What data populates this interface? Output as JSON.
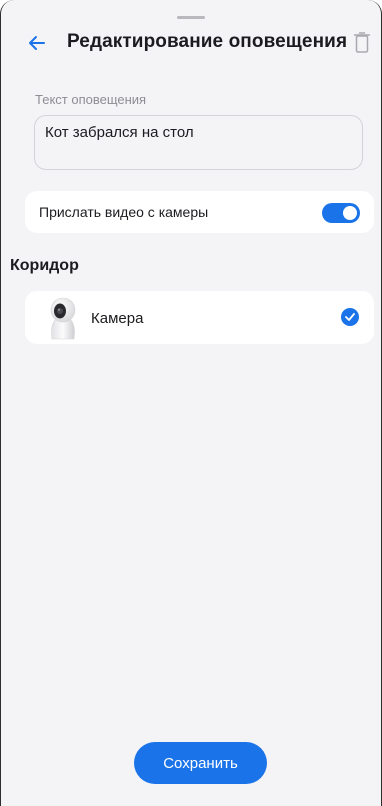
{
  "header": {
    "title": "Редактирование оповещения",
    "back_icon": "arrow-left-icon",
    "delete_icon": "trash-icon"
  },
  "notification_text": {
    "label": "Текст оповещения",
    "value": "Кот забрался на стол"
  },
  "send_video": {
    "label": "Прислать видео с камеры",
    "enabled": true
  },
  "room": {
    "title": "Коридор",
    "cameras": [
      {
        "name": "Камера",
        "icon": "camera-thumbnail",
        "selected": true
      }
    ]
  },
  "actions": {
    "save_label": "Сохранить"
  },
  "colors": {
    "accent": "#1a73e8",
    "background": "#f4f4f7",
    "card": "#ffffff",
    "text": "#1c1c20",
    "muted": "#8d8d94"
  }
}
